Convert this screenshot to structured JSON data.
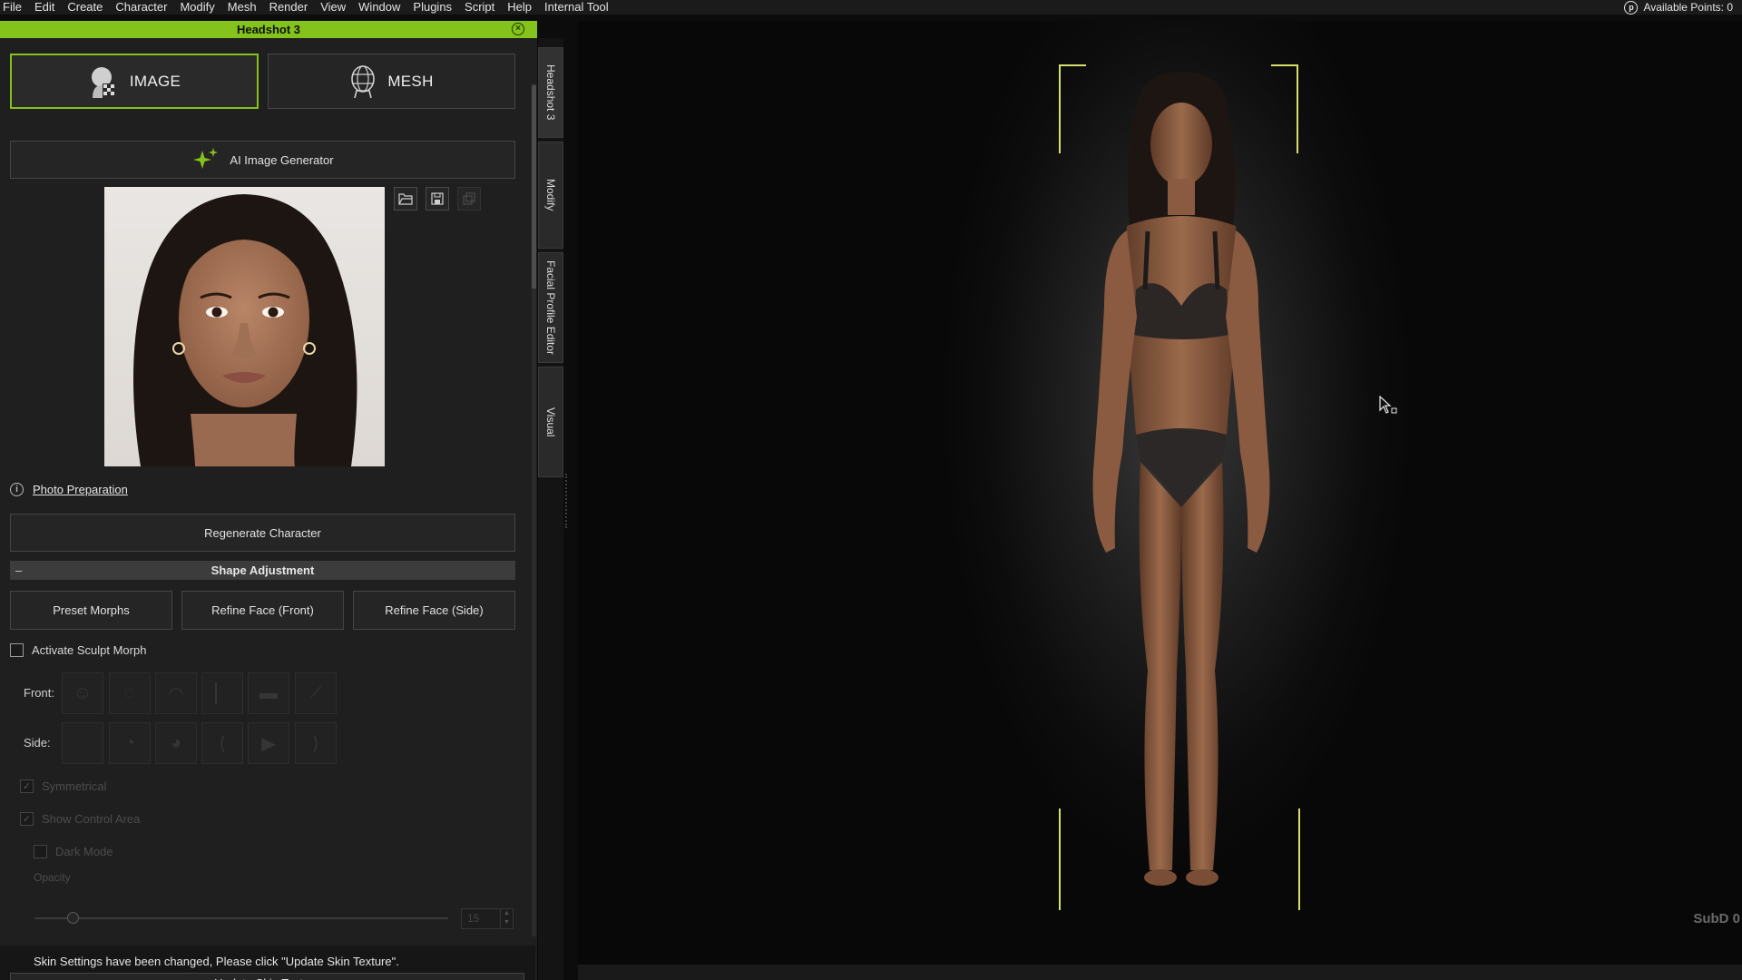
{
  "menu": [
    "File",
    "Edit",
    "Create",
    "Character",
    "Modify",
    "Mesh",
    "Render",
    "View",
    "Window",
    "Plugins",
    "Script",
    "Help",
    "Internal Tool"
  ],
  "points": {
    "label": "Available Points: 0",
    "icon": "p"
  },
  "panel": {
    "title": "Headshot 3",
    "mode_image": "IMAGE",
    "mode_mesh": "MESH",
    "ai_generator": "AI Image Generator",
    "photo_prep": "Photo Preparation",
    "regenerate": "Regenerate Character",
    "shape_section": "Shape Adjustment",
    "collapse": "–",
    "preset_morphs": "Preset Morphs",
    "refine_front": "Refine Face (Front)",
    "refine_side": "Refine Face (Side)",
    "activate_sculpt": "Activate Sculpt Morph",
    "front_label": "Front:",
    "side_label": "Side:",
    "symmetrical": "Symmetrical",
    "show_control": "Show Control Area",
    "dark_mode": "Dark Mode",
    "opacity_label": "Opacity",
    "opacity_value": "15",
    "notice": "Skin Settings have been changed, Please click \"Update Skin Texture\".",
    "update_skin": "Update Skin Texture"
  },
  "side_tabs": [
    "Headshot 3",
    "Modify",
    "Facial Profile Editor",
    "Visual"
  ],
  "viewport": {
    "subd": "SubD 0"
  },
  "colors": {
    "accent": "#84c21c",
    "bracket": "#d7e06a"
  }
}
